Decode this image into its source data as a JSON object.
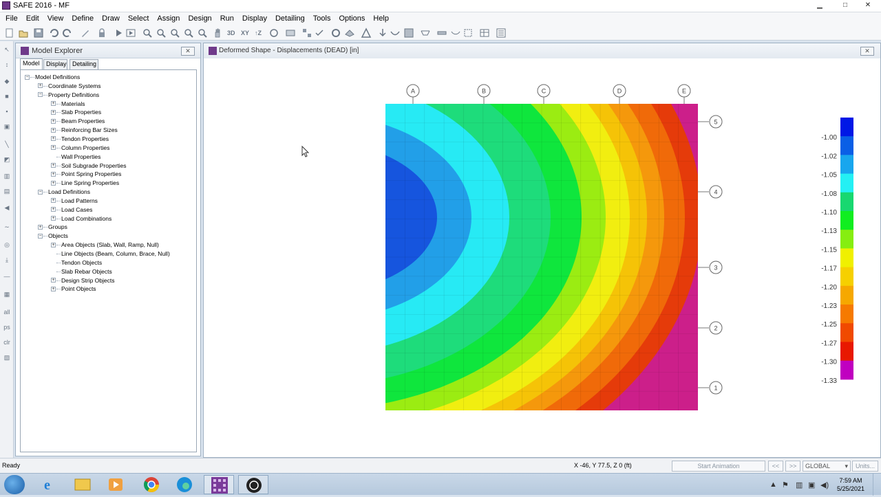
{
  "window": {
    "title": "SAFE 2016 - MF"
  },
  "menu": [
    "File",
    "Edit",
    "View",
    "Define",
    "Draw",
    "Select",
    "Assign",
    "Design",
    "Run",
    "Display",
    "Detailing",
    "Tools",
    "Options",
    "Help"
  ],
  "toolbar": {
    "icons": [
      "new-model-icon",
      "open-icon",
      "save-icon",
      "undo-icon",
      "redo-icon",
      "pencil-icon",
      "lock-icon",
      "run-icon",
      "run-all-icon",
      "zoom-in-icon",
      "zoom-out-icon",
      "zoom-window-icon",
      "zoom-previous-icon",
      "zoom-fit-icon",
      "pan-icon"
    ],
    "view_3d": "3D",
    "view_xy": "XY",
    "view_rotate": "↑Z"
  },
  "explorer": {
    "title": "Model Explorer",
    "tabs": [
      "Model",
      "Display",
      "Detailing"
    ],
    "tree": [
      {
        "label": "Model Definitions",
        "level": 0,
        "expander": "−"
      },
      {
        "label": "Coordinate Systems",
        "level": 1,
        "expander": "+"
      },
      {
        "label": "Property Definitions",
        "level": 1,
        "expander": "−"
      },
      {
        "label": "Materials",
        "level": 2,
        "expander": "+"
      },
      {
        "label": "Slab Properties",
        "level": 2,
        "expander": "+"
      },
      {
        "label": "Beam Properties",
        "level": 2,
        "expander": "+"
      },
      {
        "label": "Reinforcing Bar Sizes",
        "level": 2,
        "expander": "+"
      },
      {
        "label": "Tendon Properties",
        "level": 2,
        "expander": "+"
      },
      {
        "label": "Column Properties",
        "level": 2,
        "expander": "+"
      },
      {
        "label": "Wall Properties",
        "level": 2,
        "expander": ""
      },
      {
        "label": "Soil Subgrade Properties",
        "level": 2,
        "expander": "+"
      },
      {
        "label": "Point Spring Properties",
        "level": 2,
        "expander": "+"
      },
      {
        "label": "Line Spring Properties",
        "level": 2,
        "expander": "+"
      },
      {
        "label": "Load Definitions",
        "level": 1,
        "expander": "−"
      },
      {
        "label": "Load Patterns",
        "level": 2,
        "expander": "+"
      },
      {
        "label": "Load Cases",
        "level": 2,
        "expander": "+"
      },
      {
        "label": "Load Combinations",
        "level": 2,
        "expander": "+"
      },
      {
        "label": "Groups",
        "level": 1,
        "expander": "+"
      },
      {
        "label": "Objects",
        "level": 1,
        "expander": "−"
      },
      {
        "label": "Area Objects (Slab, Wall, Ramp, Null)",
        "level": 2,
        "expander": "+"
      },
      {
        "label": "Line Objects (Beam, Column, Brace, Null)",
        "level": 2,
        "expander": ""
      },
      {
        "label": "Tendon Objects",
        "level": 2,
        "expander": ""
      },
      {
        "label": "Slab Rebar Objects",
        "level": 2,
        "expander": ""
      },
      {
        "label": "Design Strip Objects",
        "level": 2,
        "expander": "+"
      },
      {
        "label": "Point Objects",
        "level": 2,
        "expander": "+"
      }
    ]
  },
  "view": {
    "title": "Deformed Shape - Displacements (DEAD)  [in]",
    "grid_x": [
      "A",
      "B",
      "C",
      "D",
      "E"
    ],
    "grid_y": [
      "5",
      "4",
      "3",
      "2",
      "1"
    ],
    "legend": {
      "values": [
        "-1.00",
        "-1.02",
        "-1.05",
        "-1.08",
        "-1.10",
        "-1.13",
        "-1.15",
        "-1.17",
        "-1.20",
        "-1.23",
        "-1.25",
        "-1.27",
        "-1.30",
        "-1.33"
      ],
      "colors": [
        "#0018e6",
        "#0a5fe6",
        "#18a6ee",
        "#24f0f4",
        "#18d870",
        "#10ee20",
        "#86ee10",
        "#f0f000",
        "#f6d000",
        "#f6a800",
        "#f67a00",
        "#f04a00",
        "#e81800",
        "#c000c0"
      ]
    },
    "contour_colors": [
      "#1655de",
      "#229fe8",
      "#27eaf4",
      "#1edc7b",
      "#0fe63d",
      "#9bec12",
      "#f1ee10",
      "#f5c307",
      "#f5980c",
      "#f06a09",
      "#e53b0a"
    ]
  },
  "status": {
    "ready": "Ready",
    "coords": "X -46,  Y 77.5,  Z 0  (ft)",
    "start_animation": "Start Animation",
    "prev": "<<",
    "next": ">>",
    "coord_system": "GLOBAL",
    "units": "Units..."
  },
  "taskbar": {
    "time": "7:59 AM",
    "date": "5/25/2021",
    "apps": [
      "start-orb-icon",
      "internet-explorer-icon",
      "file-explorer-icon",
      "media-player-icon",
      "chrome-icon",
      "edge-icon",
      "safe-app-icon",
      "obs-icon"
    ]
  }
}
